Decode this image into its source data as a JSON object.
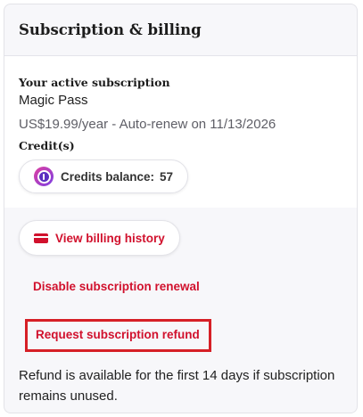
{
  "card": {
    "title": "Subscription & billing"
  },
  "subscription": {
    "heading": "Your active subscription",
    "plan_name": "Magic Pass",
    "price": "US$19.99/year",
    "renew_text": " - Auto-renew on 11/13/2026"
  },
  "credits": {
    "heading": "Credit(s)",
    "label": "Credits balance:",
    "value": "57"
  },
  "billing": {
    "history_label": "View billing history",
    "disable_label": "Disable subscription renewal",
    "refund_label": "Request subscription refund",
    "refund_note": "Refund is available for the first 14 days if subscription remains unused."
  },
  "colors": {
    "accent": "#d1112d",
    "highlight_border": "#d61f26"
  },
  "icons": {
    "credits": "credits-coin-icon",
    "billing_history": "credit-card-icon"
  }
}
